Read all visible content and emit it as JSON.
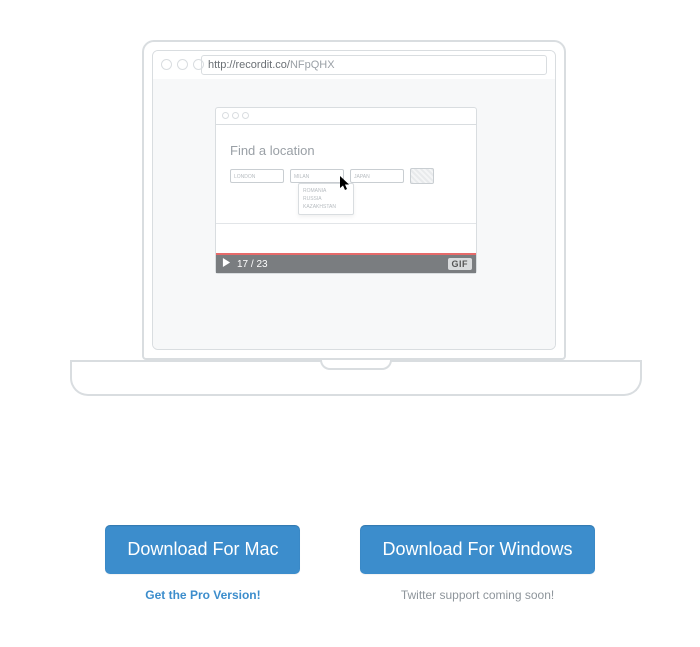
{
  "browser": {
    "url_prefix": "http://recordit.co/",
    "url_slug": "NFpQHX"
  },
  "preview": {
    "title": "Find a location",
    "inputs": [
      "LONDON",
      "MILAN",
      "JAPAN"
    ],
    "dropdown": [
      "ROMANIA",
      "RUSSIA",
      "KAZAKHSTAN"
    ]
  },
  "player": {
    "counter": "17 / 23",
    "gif_label": "GIF"
  },
  "downloads": {
    "mac": {
      "button": "Download For Mac",
      "subtext": "Get the Pro Version!"
    },
    "windows": {
      "button": "Download For Windows",
      "subtext": "Twitter support coming soon!"
    }
  }
}
